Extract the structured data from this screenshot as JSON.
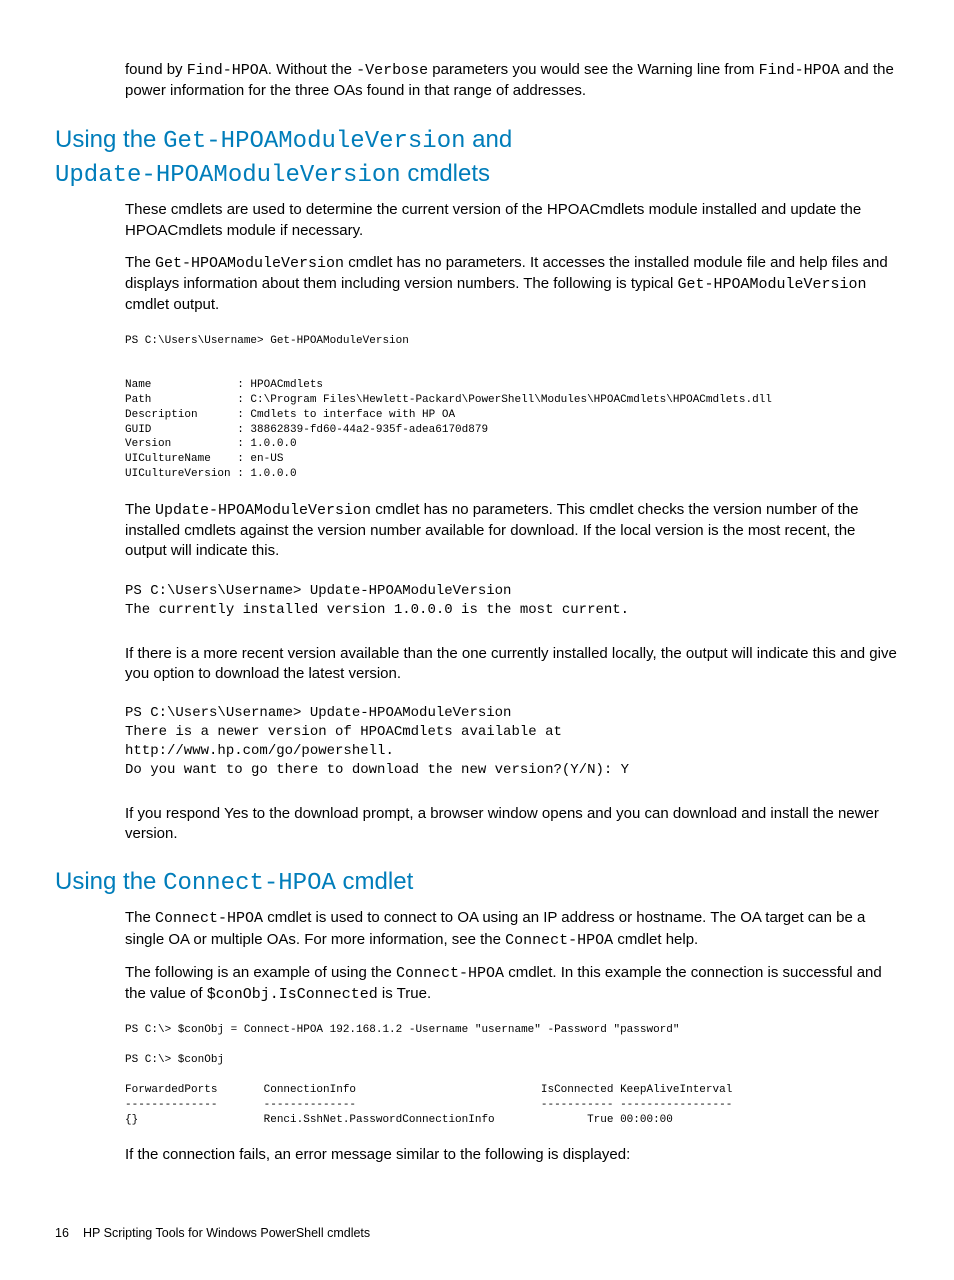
{
  "intro": {
    "p1a": "found by ",
    "p1b": "Find-HPOA",
    "p1c": ". Without the ",
    "p1d": "-Verbose",
    "p1e": " parameters you would see the Warning line from ",
    "p1f": "Find-HPOA",
    "p1g": " and the power information for the three OAs found in that range of addresses."
  },
  "sec1": {
    "h_a": "Using the ",
    "h_b": "Get-HPOAModuleVersion",
    "h_c": " and ",
    "h_d": "Update-HPOAModuleVersion",
    "h_e": " cmdlets",
    "p1": "These cmdlets are used to determine the current version of the HPOACmdlets module installed and update the HPOACmdlets module if necessary.",
    "p2a": "The ",
    "p2b": "Get-HPOAModuleVersion",
    "p2c": " cmdlet has no parameters. It accesses the installed module file and help files and displays information about them including version numbers. The following is typical ",
    "p2d": "Get-HPOAModuleVersion",
    "p2e": " cmdlet output.",
    "code1": "PS C:\\Users\\Username> Get-HPOAModuleVersion\n\n\nName             : HPOACmdlets\nPath             : C:\\Program Files\\Hewlett-Packard\\PowerShell\\Modules\\HPOACmdlets\\HPOACmdlets.dll\nDescription      : Cmdlets to interface with HP OA\nGUID             : 38862839-fd60-44a2-935f-adea6170d879\nVersion          : 1.0.0.0\nUICultureName    : en-US\nUICultureVersion : 1.0.0.0",
    "p3a": "The ",
    "p3b": "Update-HPOAModuleVersion",
    "p3c": " cmdlet has no parameters. This cmdlet checks the version number of the installed cmdlets against the version number available for download. If the local version is the most recent, the output will indicate this.",
    "code2": "PS C:\\Users\\Username> Update-HPOAModuleVersion\nThe currently installed version 1.0.0.0 is the most current.",
    "p4": "If there is a more recent version available than the one currently installed locally, the output will indicate this and give you option to download the latest version.",
    "code3": "PS C:\\Users\\Username> Update-HPOAModuleVersion\nThere is a newer version of HPOACmdlets available at\nhttp://www.hp.com/go/powershell.\nDo you want to go there to download the new version?(Y/N): Y",
    "p5": "If you respond Yes to the download prompt, a browser window opens and you can download and install the newer version."
  },
  "sec2": {
    "h_a": "Using the ",
    "h_b": "Connect-HPOA",
    "h_c": " cmdlet",
    "p1a": "The ",
    "p1b": "Connect-HPOA",
    "p1c": " cmdlet is used to connect to OA using an IP address or hostname. The OA target can be a single OA or multiple OAs. For more information, see the ",
    "p1d": "Connect-HPOA",
    "p1e": " cmdlet help.",
    "p2a": "The following is an example of using the ",
    "p2b": "Connect-HPOA",
    "p2c": " cmdlet. In this example the connection is successful and the value of ",
    "p2d": "$conObj.IsConnected",
    "p2e": " is True.",
    "code1": "PS C:\\> $conObj = Connect-HPOA 192.168.1.2 -Username \"username\" -Password \"password\"\n\nPS C:\\> $conObj\n\nForwardedPorts       ConnectionInfo                            IsConnected KeepAliveInterval\n--------------       --------------                            ----------- -----------------\n{}                   Renci.SshNet.PasswordConnectionInfo              True 00:00:00",
    "p3": "If the connection fails, an error message similar to the following is displayed:"
  },
  "footer": {
    "page": "16",
    "title": "HP Scripting Tools for Windows PowerShell cmdlets"
  }
}
